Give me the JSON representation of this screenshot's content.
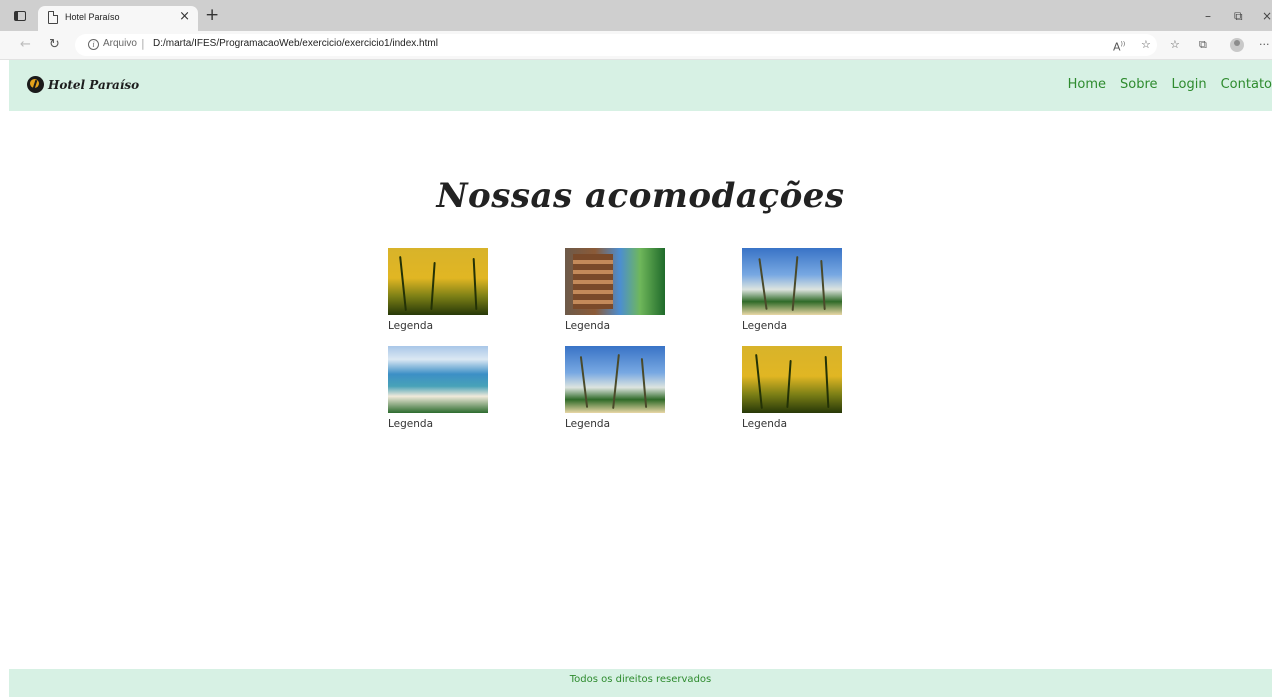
{
  "browser": {
    "tab_title": "Hotel Paraíso",
    "tab_close": "×",
    "new_tab": "+",
    "window_controls": {
      "minimize": "–",
      "restore": "⧉",
      "close": "×"
    },
    "url_scheme": "Arquivo",
    "url_separator": "|",
    "url": "D:/marta/IFES/ProgramacaoWeb/exercicio/exercicio1/index.html",
    "info_glyph": "i",
    "back_glyph": "←",
    "reload_glyph": "↻",
    "toolbar_icons": [
      "read-aloud-icon",
      "favorite-add-icon",
      "favorites-icon",
      "collections-icon",
      "profile-icon",
      "more-icon"
    ],
    "read_aloud_glyph": "A͈",
    "more_glyph": "···"
  },
  "header": {
    "logo_text": "Hotel Paraíso",
    "nav": [
      "Home",
      "Sobre",
      "Login",
      "Contato"
    ]
  },
  "main": {
    "title": "Nossas acomodações",
    "gallery": [
      {
        "image": "palm-sunset",
        "caption": "Legenda"
      },
      {
        "image": "hotel-balcony",
        "caption": "Legenda"
      },
      {
        "image": "palm-beach",
        "caption": "Legenda"
      },
      {
        "image": "coastline",
        "caption": "Legenda"
      },
      {
        "image": "palm-beach",
        "caption": "Legenda"
      },
      {
        "image": "palm-sunset",
        "caption": "Legenda"
      }
    ]
  },
  "footer": {
    "text": "Todos os direitos reservados"
  },
  "colors": {
    "header_bg": "#d7f1e4",
    "nav_link": "#2e8b2e",
    "footer_text": "#2e8b2e"
  }
}
